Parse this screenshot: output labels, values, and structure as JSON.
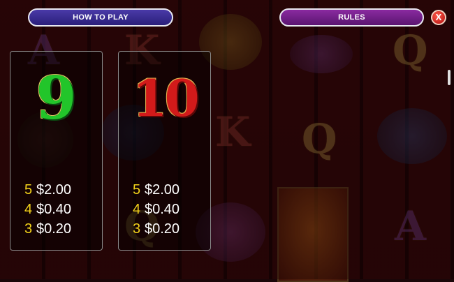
{
  "header": {
    "how_to_play_label": "HOW TO PLAY",
    "rules_label": "RULES",
    "close_label": "X"
  },
  "background": {
    "letters": [
      "A",
      "K",
      "Q",
      "K",
      "Q",
      "Q",
      "A"
    ]
  },
  "paytable": [
    {
      "symbol": "9",
      "symbol_color": "#22c52a",
      "pays": [
        {
          "count": "5",
          "value": "$2.00"
        },
        {
          "count": "4",
          "value": "$0.40"
        },
        {
          "count": "3",
          "value": "$0.20"
        }
      ]
    },
    {
      "symbol": "10",
      "symbol_color": "#d21a1a",
      "pays": [
        {
          "count": "5",
          "value": "$2.00"
        },
        {
          "count": "4",
          "value": "$0.40"
        },
        {
          "count": "3",
          "value": "$0.20"
        }
      ]
    }
  ],
  "colors": {
    "count_color": "#f2d21a",
    "how_to_play_bg": "#3a2e96",
    "rules_bg": "#7a2294",
    "close_bg": "#d01a1a"
  }
}
